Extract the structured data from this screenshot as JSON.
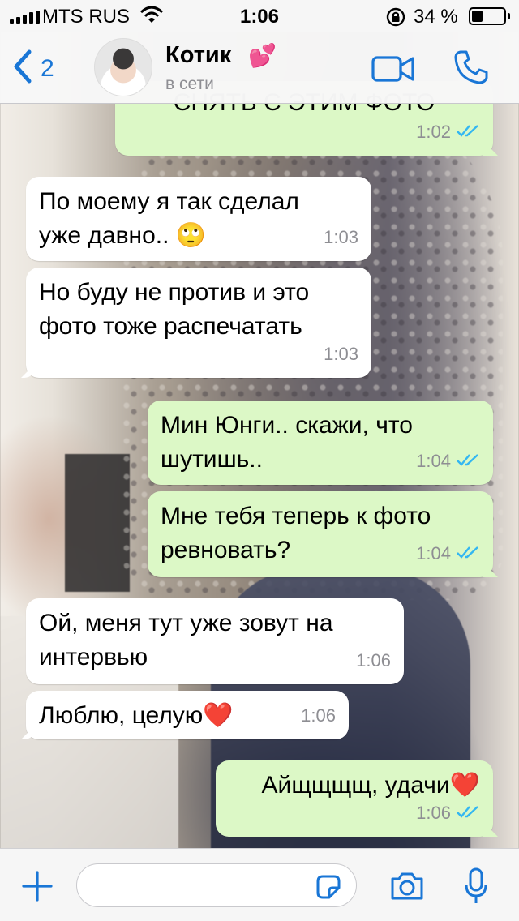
{
  "status_bar": {
    "carrier": "MTS RUS",
    "time": "1:06",
    "battery_percent_label": "34 %",
    "battery_level": 0.34
  },
  "header": {
    "back_count": "2",
    "contact_name": "Котик",
    "contact_emoji": "💕",
    "contact_status": "в сети"
  },
  "messages": [
    {
      "direction": "out",
      "text": "СНЯТЬ С ЭТИМ ФОТО",
      "time": "1:02",
      "read": true
    },
    {
      "direction": "in",
      "text": "По моему я так сделал\nуже давно.. 🙄",
      "time": "1:03"
    },
    {
      "direction": "in",
      "text": "Но буду не против и это\nфото тоже распечатать",
      "time": "1:03"
    },
    {
      "direction": "out",
      "text": "Мин Юнги.. скажи, что\nшутишь..",
      "time": "1:04",
      "read": true
    },
    {
      "direction": "out",
      "text": "Мне тебя теперь к фото\nревновать?",
      "time": "1:04",
      "read": true
    },
    {
      "direction": "in",
      "text": "Ой, меня тут уже зовут на\nинтервью",
      "time": "1:06"
    },
    {
      "direction": "in",
      "text": "Люблю, целую❤️",
      "time": "1:06"
    },
    {
      "direction": "out",
      "text": "Айщщщщ, удачи❤️",
      "time": "1:06",
      "read": true
    }
  ],
  "colors": {
    "accent": "#1976d6",
    "incoming_bubble": "#ffffff",
    "outgoing_bubble": "#dcf8c6",
    "read_ticks": "#34b7f1"
  },
  "icons": {
    "back": "chevron-left-icon",
    "video": "video-camera-icon",
    "call": "phone-icon",
    "attach": "plus-icon",
    "sticker": "sticker-icon",
    "camera": "camera-icon",
    "mic": "microphone-icon"
  }
}
